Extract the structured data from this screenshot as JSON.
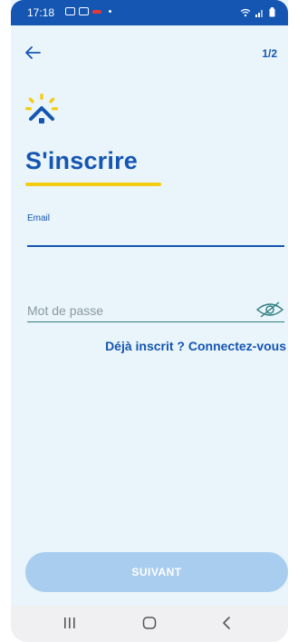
{
  "status_bar": {
    "time": "17:18"
  },
  "header": {
    "step": "1/2"
  },
  "page": {
    "title": "S'inscrire"
  },
  "form": {
    "email_label": "Email",
    "email_value": "",
    "password_placeholder": "Mot de passe",
    "password_value": "",
    "login_link": "Déjà inscrit ? Connectez-vous",
    "submit_label": "SUIVANT"
  },
  "colors": {
    "primary": "#1556b2",
    "accent": "#f5cc14",
    "background": "#e9f4fb",
    "button_disabled": "#a9cdee"
  },
  "icons": {
    "back": "arrow-left-icon",
    "logo": "sun-house-logo",
    "password_toggle": "eye-slash-icon",
    "nav_recents": "recents-icon",
    "nav_home": "home-icon",
    "nav_back": "back-chevron-icon"
  }
}
